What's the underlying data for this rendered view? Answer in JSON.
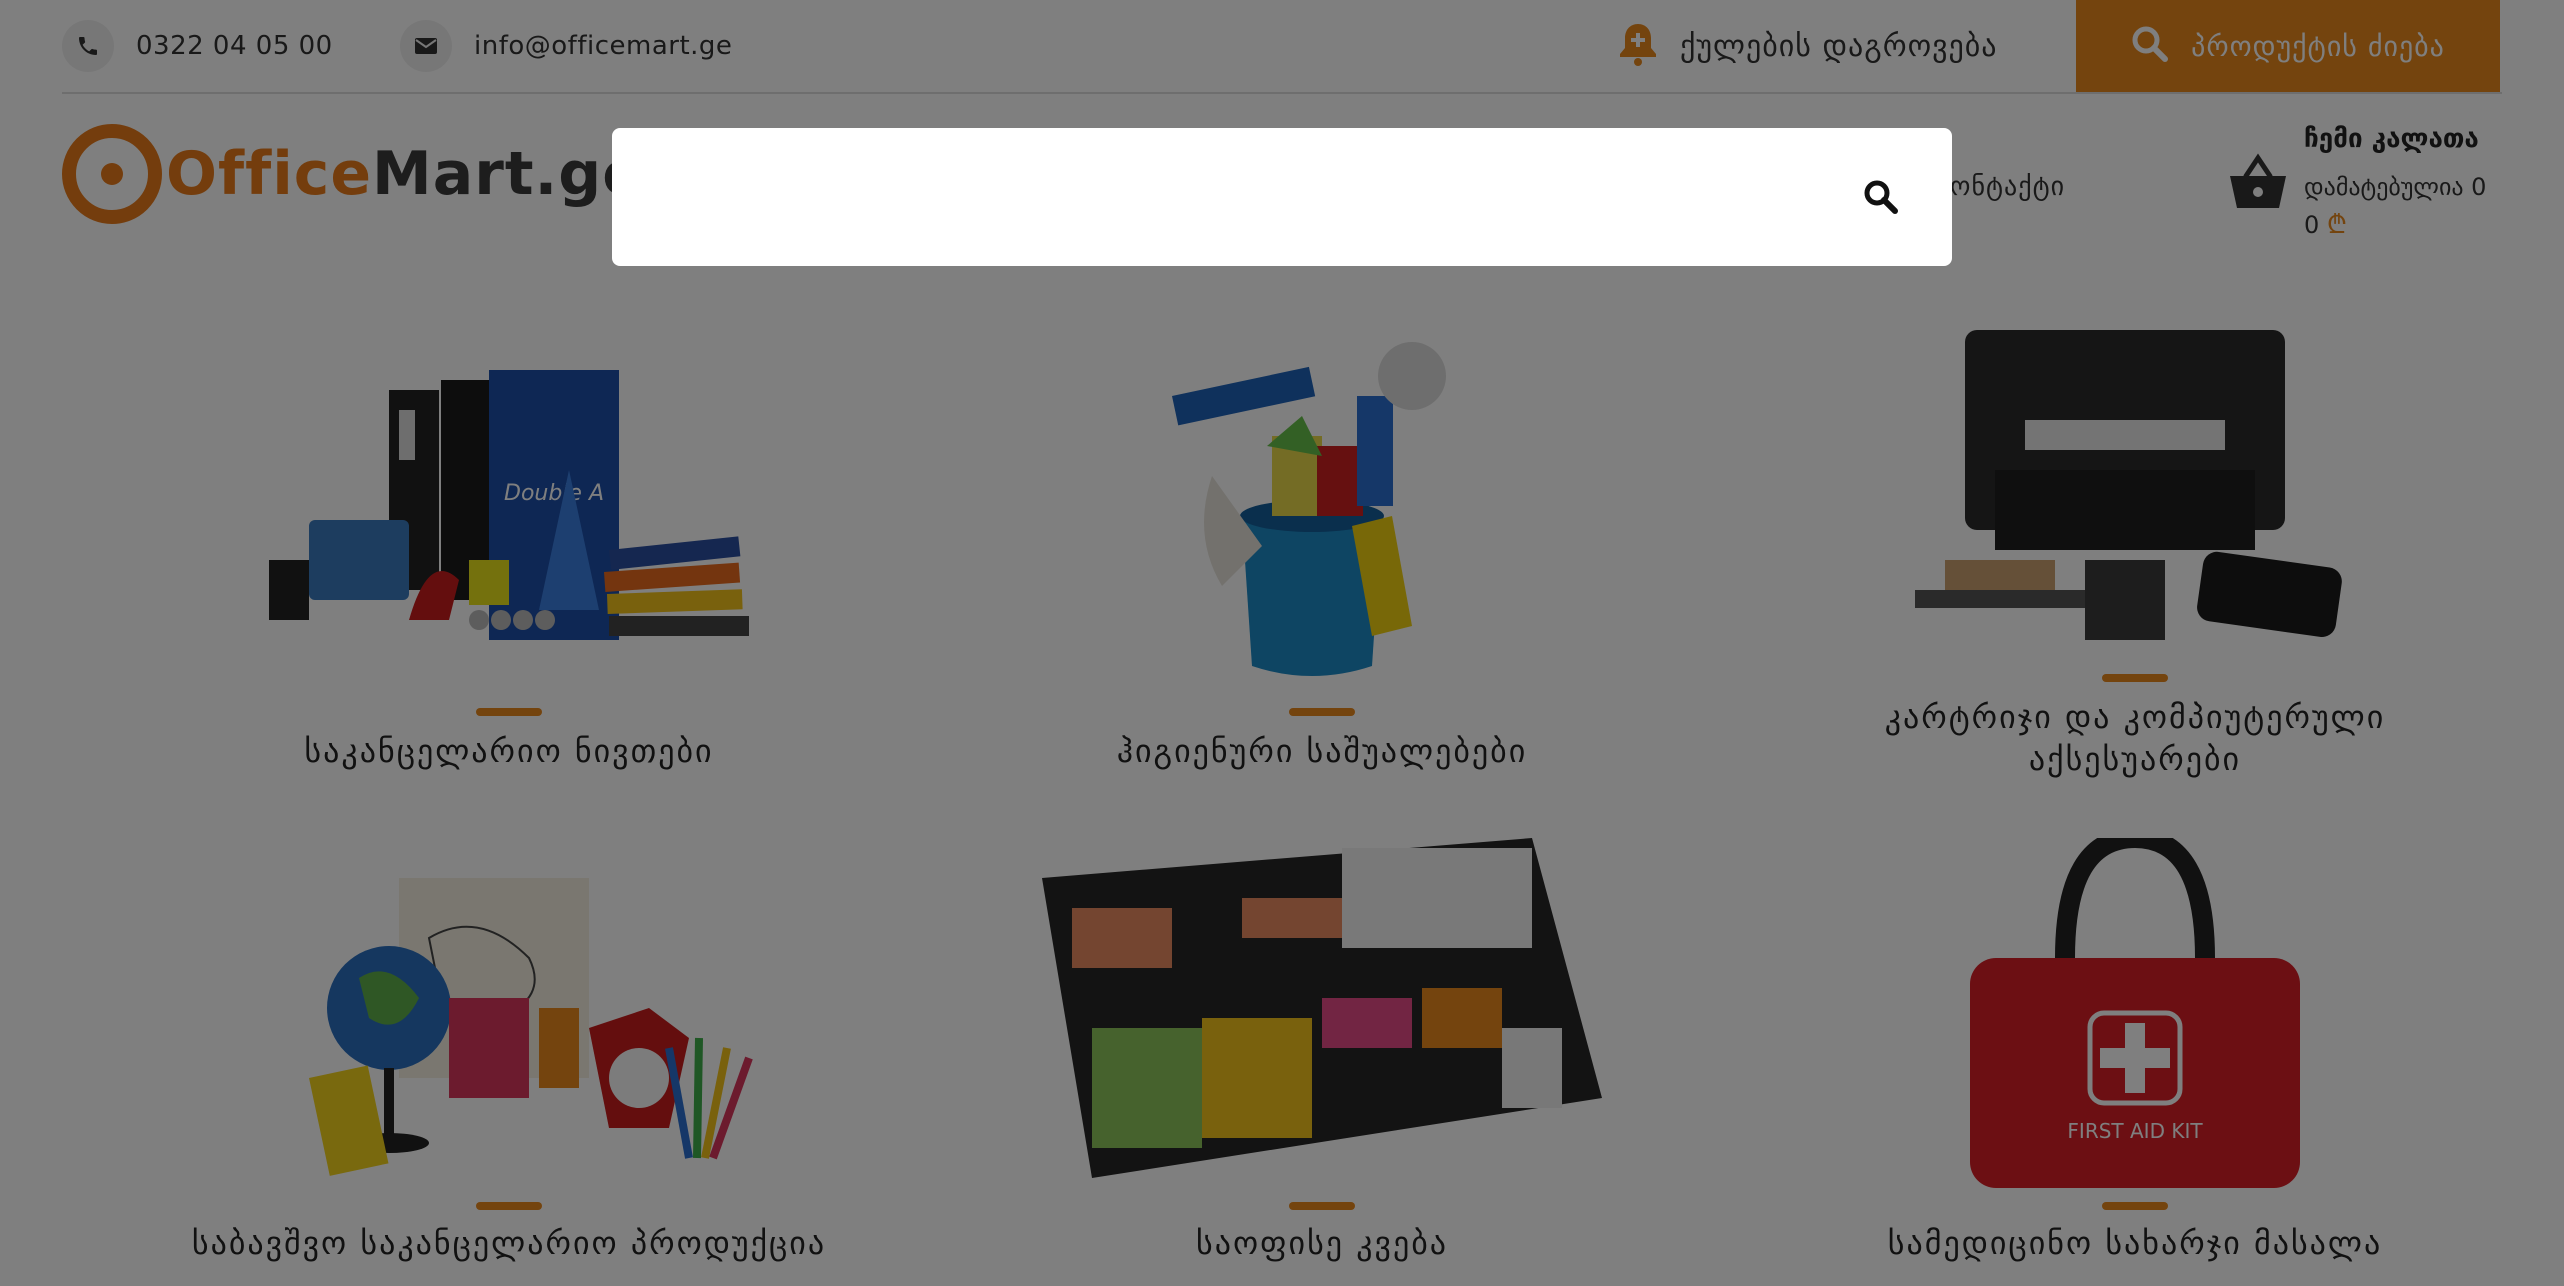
{
  "topbar": {
    "phone": "0322 04 05 00",
    "email": "info@officemart.ge",
    "bonus_label": "ქულების დაგროვება",
    "search_label": "პროდუქტის ძიება",
    "icons": {
      "phone": "phone-icon",
      "email": "email-icon",
      "bonus": "bell-plus-icon",
      "search": "search-icon"
    }
  },
  "header": {
    "logo_part1": "Office",
    "logo_part2": "Mart.ge",
    "nav_contact": "ონტაქტი",
    "cart": {
      "title": "ჩემი კალათა",
      "added": "დამატებულია 0",
      "total": "0",
      "currency_symbol": "₾",
      "icon": "basket-icon"
    }
  },
  "categories": [
    {
      "label": "საკანცელარიო ნივთები"
    },
    {
      "label": "ჰიგიენური საშუალებები"
    },
    {
      "label": "კარტრიჯი და კომპიუტერული აქსესუარები"
    },
    {
      "label": "საბავშვო საკანცელარიო პროდუქცია"
    },
    {
      "label": "საოფისე კვება"
    },
    {
      "label": "სამედიცინო სახარჯი მასალა"
    }
  ],
  "search_modal": {
    "placeholder": "",
    "value": "",
    "icon": "search-icon"
  },
  "colors": {
    "accent": "#e8891d",
    "overlay": "rgba(0,0,0,0.5)"
  }
}
